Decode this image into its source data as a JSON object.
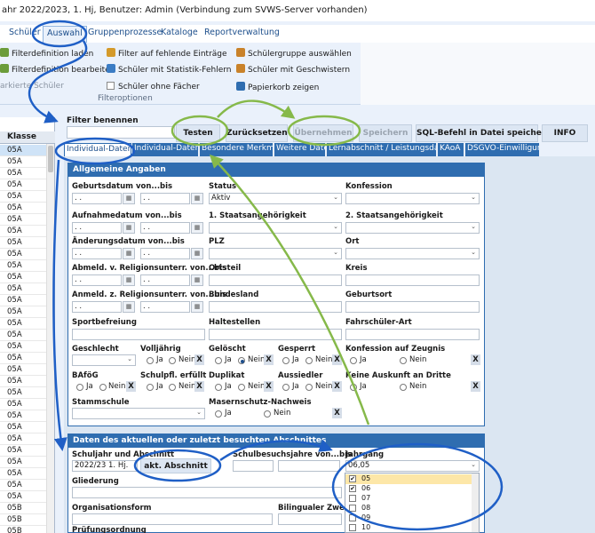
{
  "window": {
    "title": "ahr 2022/2023, 1. Hj, Benutzer: Admin (Verbindung zum SVWS-Server vorhanden)"
  },
  "menu": {
    "items": [
      "Schüler",
      "Auswahl",
      "Gruppenprozesse",
      "Kataloge",
      "Reportverwaltung"
    ],
    "active": "Auswahl"
  },
  "ribbon": {
    "col1": [
      "Filterdefinition laden",
      "Filterdefinition bearbeiten",
      "arkierte Schüler"
    ],
    "col2": [
      "Filter auf fehlende Einträge",
      "Schüler mit Statistik-Fehlern",
      "Schüler ohne Fächer"
    ],
    "col3": [
      "Schülergruppe auswählen",
      "Schüler mit Geschwistern",
      "Papierkorb zeigen"
    ],
    "group_label": "Filteroptionen"
  },
  "student_list": {
    "header": "Klasse",
    "rows": [
      "05A",
      "05A",
      "05A",
      "05A",
      "05A",
      "05A",
      "05A",
      "05A",
      "05A",
      "05A",
      "05A",
      "05A",
      "05A",
      "05A",
      "05A",
      "05A",
      "05A",
      "05A",
      "05A",
      "05A",
      "05A",
      "05A",
      "05A",
      "05A",
      "05A",
      "05A",
      "05A",
      "05A",
      "05A",
      "05A",
      "05A",
      "05B",
      "05B",
      "05B",
      "05B"
    ]
  },
  "filter": {
    "label": "Filter benennen",
    "buttons": {
      "testen": "Testen",
      "zuruecksetzen": "Zurücksetzen",
      "uebernehmen": "Übernehmen",
      "speichern": "Speichern",
      "sql": "SQL-Befehl in Datei speichern",
      "info": "INFO"
    }
  },
  "tabs": [
    "Individual-Daten I",
    "Individual-Daten II",
    "Besondere Merkmale",
    "Weitere Daten",
    "Lernabschnitt / Leistungsdaten",
    "KAoA",
    "DSGVO-Einwilligung"
  ],
  "allgemein": {
    "title": "Allgemeine Angaben",
    "geburtsdatum": "Geburtsdatum von...bis",
    "status": "Status",
    "status_value": "Aktiv",
    "konfession": "Konfession",
    "aufnahmedatum": "Aufnahmedatum von...bis",
    "staatsang1": "1. Staatsangehörigkeit",
    "staatsang2": "2. Staatsangehörigkeit",
    "aenderungsdatum": "Änderungsdatum von...bis",
    "plz": "PLZ",
    "ort": "Ort",
    "abmeld": "Abmeld. v. Religionsunterr. von...bis",
    "ortsteil": "Ortsteil",
    "kreis": "Kreis",
    "anmeld": "Anmeld. z. Religionsunterr. von...bis",
    "bundesland": "Bundesland",
    "geburtsort": "Geburtsort",
    "sportbefreiung": "Sportbefreiung",
    "haltestellen": "Haltestellen",
    "fahrschueler": "Fahrschüler-Art",
    "geschlecht": "Geschlecht",
    "volljaehrig": "Volljährig",
    "geloescht": "Gelöscht",
    "gesperrt": "Gesperrt",
    "konf_zeugnis": "Konfession auf Zeugnis",
    "bafoeg": "BAföG",
    "schulpfl": "Schulpfl. erfüllt",
    "duplikat": "Duplikat",
    "aussiedler": "Aussiedler",
    "keine_auskunft": "Keine Auskunft an Dritte",
    "stammschule": "Stammschule",
    "masernschutz": "Masernschutz-Nachweis",
    "ja": "Ja",
    "nein": "Nein",
    "x": "X",
    "date_placeholder": ". ."
  },
  "abschnitt": {
    "title": "Daten des aktuellen oder zuletzt besuchten Abschnittes",
    "schuljahr": "Schuljahr und Abschnitt",
    "schuljahr_value": "2022/23 1. Hj.",
    "akt_button": "akt. Abschnitt",
    "schulbesuchsjahre": "Schulbesuchsjahre von...bis",
    "jahrgang": "Jahrgang",
    "jahrgang_value": "06,05",
    "gliederung": "Gliederung",
    "organisationsform": "Organisationsform",
    "bilingualer_zweig": "Bilingualer Zweig",
    "pruefungsordnung": "Prüfungsordnung",
    "jahrgang_options": [
      {
        "value": "05",
        "checked": true,
        "highlight": true
      },
      {
        "value": "06",
        "checked": true,
        "highlight": false
      },
      {
        "value": "07",
        "checked": false,
        "highlight": false
      },
      {
        "value": "08",
        "checked": false,
        "highlight": false
      },
      {
        "value": "09",
        "checked": false,
        "highlight": false
      },
      {
        "value": "10",
        "checked": false,
        "highlight": false
      }
    ]
  },
  "colors": {
    "accent": "#2f6db0",
    "annotation_blue": "#1f5fc6",
    "annotation_green": "#86b94a"
  }
}
